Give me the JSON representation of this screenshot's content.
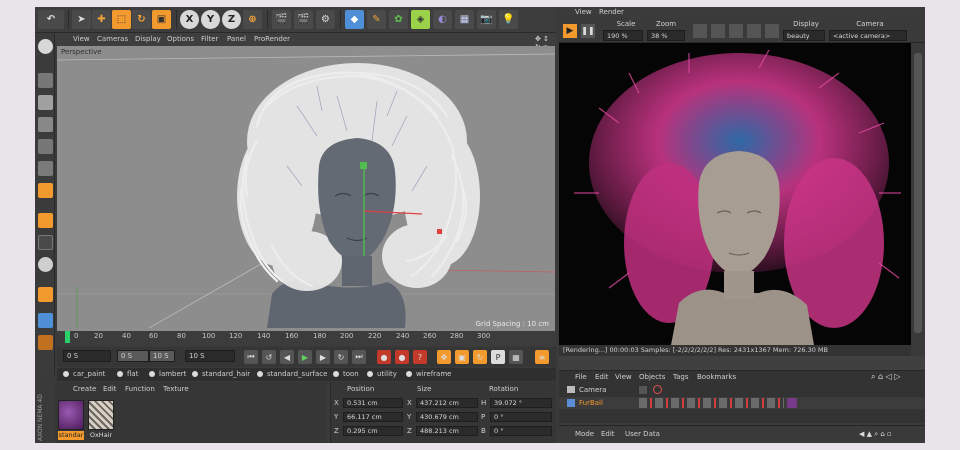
{
  "viewport": {
    "menu": [
      "View",
      "Cameras",
      "Display",
      "Options",
      "Filter",
      "Panel",
      "ProRender"
    ],
    "label": "Perspective",
    "grid_spacing": "Grid Spacing : 10 cm"
  },
  "timeline": {
    "ticks": [
      "0",
      "20",
      "40",
      "60",
      "80",
      "100",
      "120",
      "140",
      "160",
      "180",
      "200",
      "220",
      "240",
      "260",
      "280",
      "300"
    ],
    "start_field": "0 S",
    "range_start": "0 S",
    "range_end": "10 S",
    "end_field": "10 S"
  },
  "material_bar": [
    "car_paint",
    "flat",
    "lambert",
    "standard_hair",
    "standard_surface",
    "toon",
    "utility",
    "wireframe"
  ],
  "material_manager": {
    "menu": [
      "Create",
      "Edit",
      "Function",
      "Texture"
    ],
    "materials": [
      {
        "label": "standar",
        "color": "#7a3a8a"
      },
      {
        "label": "OxHair",
        "color": "#b8b0a4"
      }
    ]
  },
  "coordinates": {
    "headers": [
      "Position",
      "Size",
      "Rotation"
    ],
    "rows": [
      {
        "axis": "X",
        "position": "0.531 cm",
        "size_axis": "X",
        "size": "437.212 cm",
        "rot_axis": "H",
        "rotation": "39.072 °"
      },
      {
        "axis": "Y",
        "position": "66.117 cm",
        "size_axis": "Y",
        "size": "430.679 cm",
        "rot_axis": "P",
        "rotation": "0 °"
      },
      {
        "axis": "Z",
        "position": "0.295 cm",
        "size_axis": "Z",
        "size": "488.213 cm",
        "rot_axis": "B",
        "rotation": "0 °"
      }
    ]
  },
  "render_view": {
    "menu": [
      "View",
      "Render"
    ],
    "scale_label": "Scale",
    "scale_value": "190 %",
    "zoom_label": "Zoom",
    "zoom_value": "38 %",
    "display_label": "Display",
    "display_value": "beauty",
    "camera_label": "Camera",
    "camera_value": "<active camera>",
    "status": "[Rendering...] 00:00:03  Samples: [-2/2/2/2/2/2]  Res: 2431x1367  Mem: 726.30 MB"
  },
  "object_manager": {
    "menu": [
      "File",
      "Edit",
      "View",
      "Objects",
      "Tags",
      "Bookmarks"
    ],
    "objects": [
      "Camera",
      "FurBall"
    ]
  },
  "attributes": {
    "menu": [
      "Mode",
      "Edit",
      "User Data"
    ]
  },
  "side_label": "AXON NEMA 4D",
  "colors": {
    "accent_orange": "#f29a2e",
    "hair_pink": "#d6358f",
    "hair_blue": "#2f6fae"
  }
}
